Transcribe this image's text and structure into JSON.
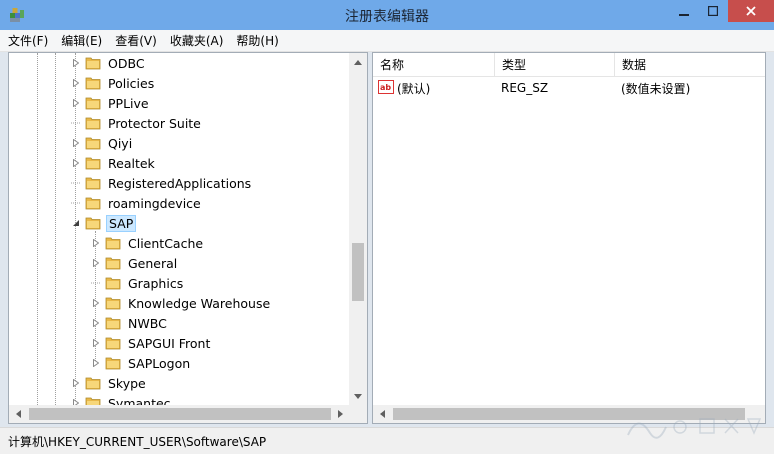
{
  "window": {
    "title": "注册表编辑器",
    "icon": "registry-editor-icon"
  },
  "menu": [
    "文件(F)",
    "编辑(E)",
    "查看(V)",
    "收藏夹(A)",
    "帮助(H)"
  ],
  "tree": {
    "items": [
      {
        "label": "ODBC",
        "expander": "collapsed",
        "level": 0
      },
      {
        "label": "Policies",
        "expander": "collapsed",
        "level": 0
      },
      {
        "label": "PPLive",
        "expander": "collapsed",
        "level": 0
      },
      {
        "label": "Protector Suite",
        "expander": "none",
        "level": 0
      },
      {
        "label": "Qiyi",
        "expander": "collapsed",
        "level": 0
      },
      {
        "label": "Realtek",
        "expander": "collapsed",
        "level": 0
      },
      {
        "label": "RegisteredApplications",
        "expander": "none",
        "level": 0
      },
      {
        "label": "roamingdevice",
        "expander": "none",
        "level": 0
      },
      {
        "label": "SAP",
        "expander": "expanded",
        "level": 0,
        "selected": true
      },
      {
        "label": "ClientCache",
        "expander": "collapsed",
        "level": 1
      },
      {
        "label": "General",
        "expander": "collapsed",
        "level": 1
      },
      {
        "label": "Graphics",
        "expander": "none",
        "level": 1
      },
      {
        "label": "Knowledge Warehouse",
        "expander": "collapsed",
        "level": 1
      },
      {
        "label": "NWBC",
        "expander": "collapsed",
        "level": 1
      },
      {
        "label": "SAPGUI Front",
        "expander": "collapsed",
        "level": 1
      },
      {
        "label": "SAPLogon",
        "expander": "collapsed",
        "level": 1
      },
      {
        "label": "Skype",
        "expander": "collapsed",
        "level": 0
      },
      {
        "label": "Symantec",
        "expander": "collapsed",
        "level": 0
      }
    ]
  },
  "list": {
    "columns": [
      "名称",
      "类型",
      "数据"
    ],
    "rows": [
      {
        "name": "(默认)",
        "type": "REG_SZ",
        "data": "(数值未设置)",
        "icon": "string-value-icon"
      }
    ]
  },
  "status": {
    "path": "计算机\\HKEY_CURRENT_USER\\Software\\SAP"
  },
  "colors": {
    "titlebar": "#6fa9e9",
    "close_button": "#c74e4c",
    "selection_bg": "#cce8ff",
    "folder": "#e8b84a"
  }
}
